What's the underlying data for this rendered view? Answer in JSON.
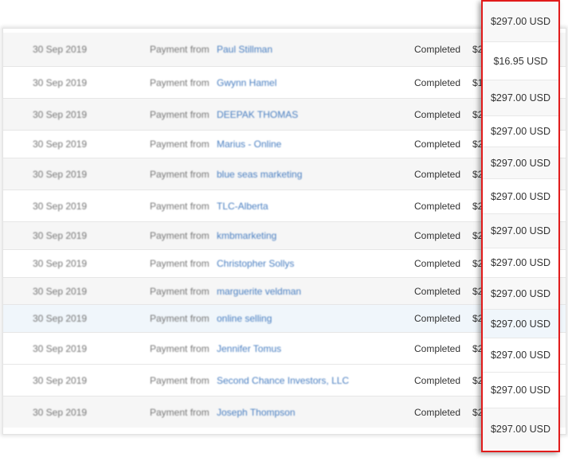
{
  "transactions": [
    {
      "date": "30 Sep 2019",
      "desc": "Payment from",
      "name": "Paul Stillman",
      "status": "Completed",
      "amount": "$297.00 USD",
      "amount_clip": "$297"
    },
    {
      "date": "30 Sep 2019",
      "desc": "Payment from",
      "name": "Gwynn Hamel",
      "status": "Completed",
      "amount": "$16.95 USD",
      "amount_clip": "$16"
    },
    {
      "date": "30 Sep 2019",
      "desc": "Payment from",
      "name": "DEEPAK THOMAS",
      "status": "Completed",
      "amount": "$297.00 USD",
      "amount_clip": "$297"
    },
    {
      "date": "30 Sep 2019",
      "desc": "Payment from",
      "name": "Marius - Online",
      "status": "Completed",
      "amount": "$297.00 USD",
      "amount_clip": "$297"
    },
    {
      "date": "30 Sep 2019",
      "desc": "Payment from",
      "name": "blue seas marketing",
      "status": "Completed",
      "amount": "$297.00 USD",
      "amount_clip": "$297"
    },
    {
      "date": "30 Sep 2019",
      "desc": "Payment from",
      "name": "TLC-Alberta",
      "status": "Completed",
      "amount": "$297.00 USD",
      "amount_clip": "$297"
    },
    {
      "date": "30 Sep 2019",
      "desc": "Payment from",
      "name": "kmbmarketing",
      "status": "Completed",
      "amount": "$297.00 USD",
      "amount_clip": "$297"
    },
    {
      "date": "30 Sep 2019",
      "desc": "Payment from",
      "name": "Christopher Sollys",
      "status": "Completed",
      "amount": "$297.00 USD",
      "amount_clip": "$297"
    },
    {
      "date": "30 Sep 2019",
      "desc": "Payment from",
      "name": "marguerite veldman",
      "status": "Completed",
      "amount": "$297.00 USD",
      "amount_clip": "$297"
    },
    {
      "date": "30 Sep 2019",
      "desc": "Payment from",
      "name": "online selling",
      "status": "Completed",
      "amount": "$297.00 USD",
      "amount_clip": "$297"
    },
    {
      "date": "30 Sep 2019",
      "desc": "Payment from",
      "name": "Jennifer Tomus",
      "status": "Completed",
      "amount": "$297.00 USD",
      "amount_clip": "$297"
    },
    {
      "date": "30 Sep 2019",
      "desc": "Payment from",
      "name": "Second Chance Investors, LLC",
      "status": "Completed",
      "amount": "$297.00 USD",
      "amount_clip": "$297"
    },
    {
      "date": "30 Sep 2019",
      "desc": "Payment from",
      "name": "Joseph Thompson",
      "status": "Completed",
      "amount": "$297.00 USD",
      "amount_clip": "$297"
    }
  ],
  "colors": {
    "highlight_border": "#e11b1b",
    "link": "#4a7fc1",
    "row_alt": "#f6f6f6",
    "row_hover": "#f0f6fb"
  }
}
